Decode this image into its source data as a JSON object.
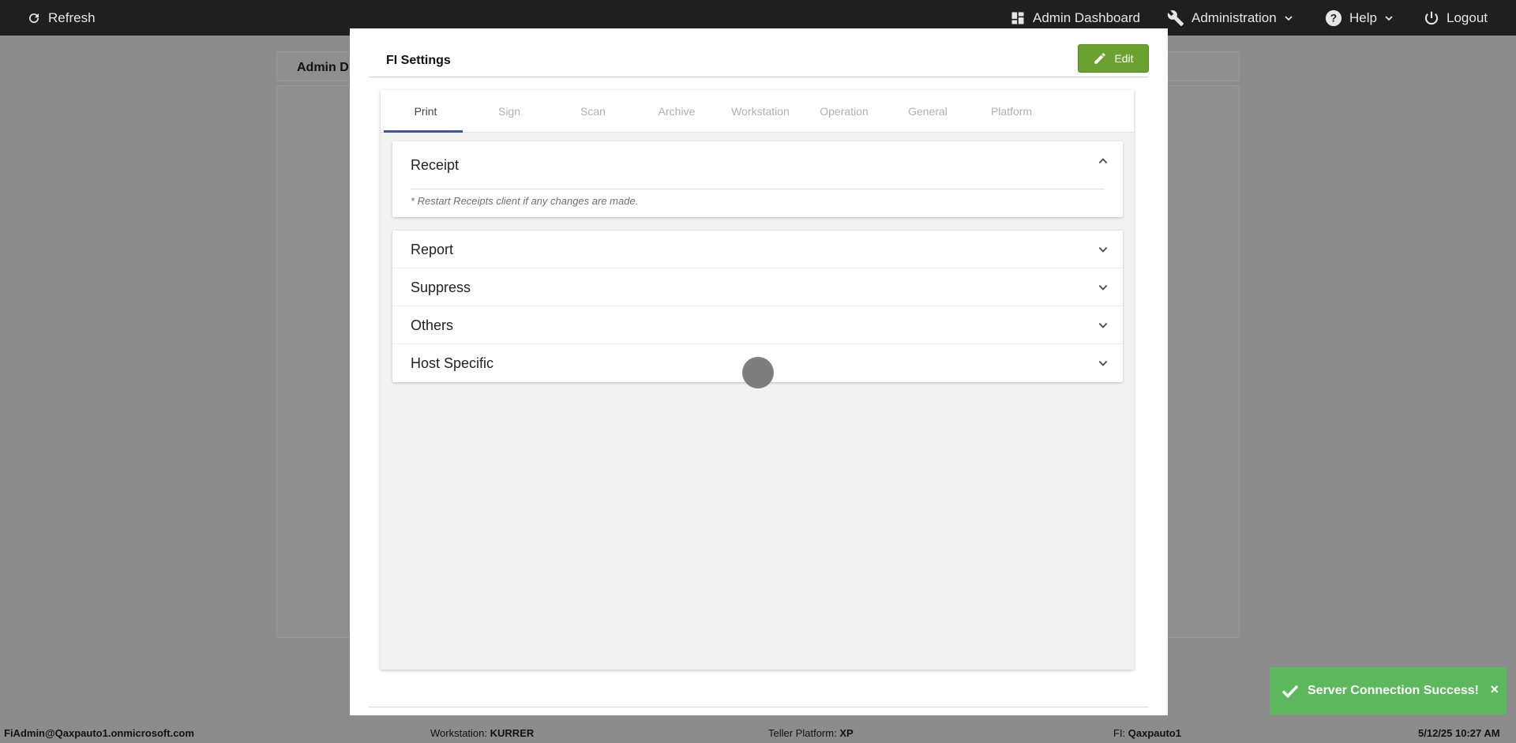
{
  "topbar": {
    "refresh_label": "Refresh",
    "admin_dashboard_label": "Admin Dashboard",
    "administration_label": "Administration",
    "help_label": "Help",
    "logout_label": "Logout"
  },
  "background": {
    "header_title": "Admin D"
  },
  "modal": {
    "title": "FI Settings",
    "edit_label": "Edit",
    "tabs": [
      "Print",
      "Sign",
      "Scan",
      "Archive",
      "Workstation",
      "Operation",
      "General",
      "Platform"
    ],
    "active_tab": "Print",
    "receipt": {
      "title": "Receipt",
      "note": "* Restart Receipts client if any changes are made."
    },
    "sections": [
      "Report",
      "Suppress",
      "Others",
      "Host Specific"
    ]
  },
  "toast": {
    "message": "Server Connection Success!",
    "close": "×"
  },
  "statusbar": {
    "user": "FiAdmin@Qaxpauto1.onmicrosoft.com",
    "workstation_label": "Workstation:",
    "workstation_value": "KURRER",
    "platform_label": "Teller Platform:",
    "platform_value": "XP",
    "fi_label": "FI:",
    "fi_value": "Qaxpauto1",
    "datetime": "5/12/25 10:27 AM"
  },
  "colors": {
    "topbar": "#1f1f1f",
    "edit_button": "#6aa12f",
    "tab_indicator": "#3f51b5",
    "toast": "#5cb85c"
  }
}
